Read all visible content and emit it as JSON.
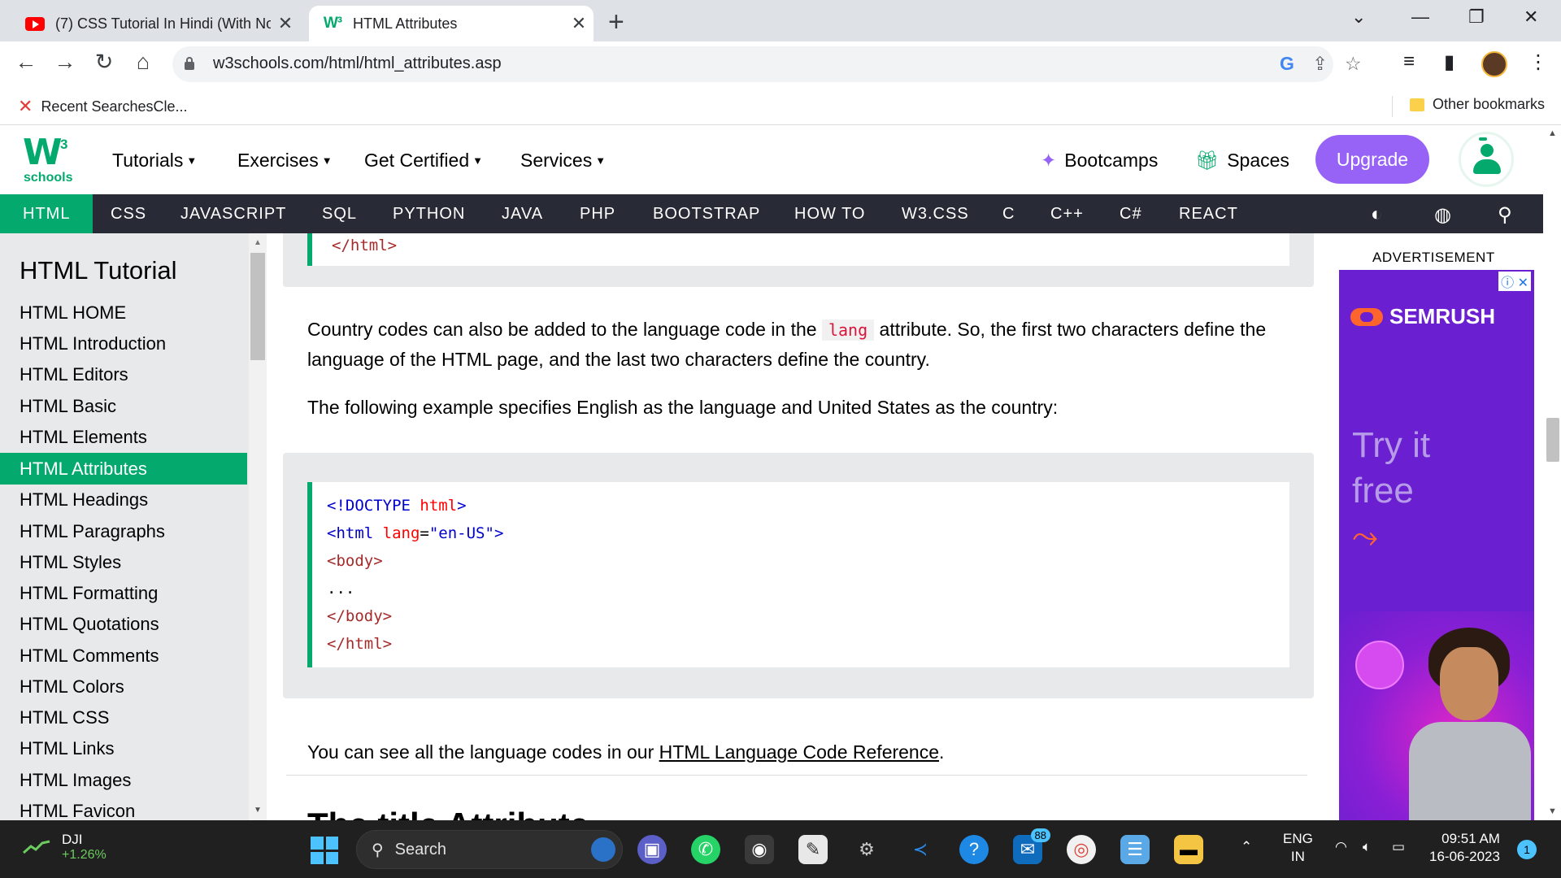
{
  "browser": {
    "tabs": [
      {
        "title": "(7) CSS Tutorial In Hindi (With No"
      },
      {
        "title": "HTML Attributes"
      }
    ],
    "url": "w3schools.com/html/html_attributes.asp",
    "bookmarks": {
      "left": "Recent SearchesCle...",
      "right": "Other bookmarks"
    }
  },
  "w3": {
    "logo_big": "W",
    "logo_sup": "3",
    "logo_small": "schools",
    "menu": [
      "Tutorials",
      "Exercises",
      "Get Certified",
      "Services"
    ],
    "bootcamps": "Bootcamps",
    "spaces": "Spaces",
    "upgrade": "Upgrade",
    "topnav": [
      "HTML",
      "CSS",
      "JAVASCRIPT",
      "SQL",
      "PYTHON",
      "JAVA",
      "PHP",
      "BOOTSTRAP",
      "HOW TO",
      "W3.CSS",
      "C",
      "C++",
      "C#",
      "REACT"
    ]
  },
  "sidebar": {
    "title": "HTML Tutorial",
    "items": [
      "HTML HOME",
      "HTML Introduction",
      "HTML Editors",
      "HTML Basic",
      "HTML Elements",
      "HTML Attributes",
      "HTML Headings",
      "HTML Paragraphs",
      "HTML Styles",
      "HTML Formatting",
      "HTML Quotations",
      "HTML Comments",
      "HTML Colors",
      "HTML CSS",
      "HTML Links",
      "HTML Images",
      "HTML Favicon"
    ],
    "active": "HTML Attributes"
  },
  "main": {
    "code_top_line": "</html>",
    "para1_a": "Country codes can also be added to the language code in the ",
    "para1_kw": "lang",
    "para1_b": " attribute. So, the first two characters define the language of the HTML page, and the last two characters define the country.",
    "para2": "The following example specifies English as the language and United States as the country:",
    "code": {
      "l1_open": "<!DOCTYPE",
      "l1_name": " html",
      "l1_close": ">",
      "l2_open": "<html",
      "l2_attr": " lang",
      "l2_eq": "=",
      "l2_val": "\"en-US\"",
      "l2_close": ">",
      "l3": "<body>",
      "l4": "...",
      "l5": "</body>",
      "l6": "</html>"
    },
    "para3_a": "You can see all the language codes in our ",
    "para3_link": "HTML Language Code Reference",
    "para3_b": ".",
    "next_heading": "The title Attribute"
  },
  "ad": {
    "label": "ADVERTISEMENT",
    "brand": "SEMRUSH",
    "line1": "Try it",
    "line2": "free",
    "arrow": "⤳"
  },
  "taskbar": {
    "stock_name": "DJI",
    "stock_change": "+1.26%",
    "search": "Search",
    "badge_count": "88",
    "lang_line1": "ENG",
    "lang_line2": "IN",
    "time": "09:51 AM",
    "date": "16-06-2023",
    "notifications": "1"
  }
}
